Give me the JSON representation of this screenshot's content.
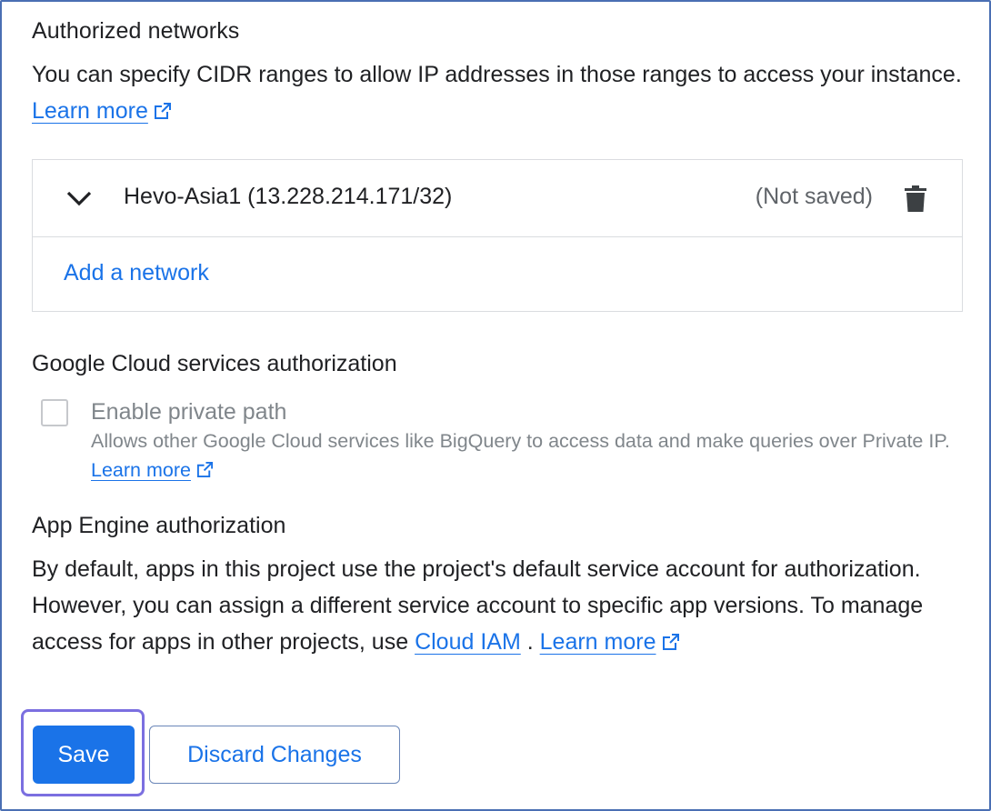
{
  "authorized_networks": {
    "title": "Authorized networks",
    "description": "You can specify CIDR ranges to allow IP addresses in those ranges to access your instance.",
    "learn_more": "Learn more",
    "networks": [
      {
        "label": "Hevo-Asia1 (13.228.214.171/32)",
        "status": "(Not saved)"
      }
    ],
    "add_network": "Add a network"
  },
  "gcs_authorization": {
    "title": "Google Cloud services authorization",
    "checkbox_label": "Enable private path",
    "checkbox_checked": false,
    "help_text": "Allows other Google Cloud services like BigQuery to access data and make queries over Private IP.",
    "learn_more": "Learn more"
  },
  "app_engine": {
    "title": "App Engine authorization",
    "description_part1": "By default, apps in this project use the project's default service account for authorization. However, you can assign a different service account to specific app versions. To manage access for apps in other projects, use",
    "cloud_iam_link": "Cloud IAM",
    "separator": ".",
    "learn_more": "Learn more"
  },
  "actions": {
    "save": "Save",
    "discard": "Discard Changes"
  },
  "colors": {
    "link": "#1a73e8",
    "primary_button": "#1a73e8",
    "focus_ring": "#7b6fe0",
    "frame_border": "#4a6fb3"
  },
  "icons": {
    "expand": "chevron-down-icon",
    "delete": "trash-icon",
    "external": "external-link-icon"
  }
}
